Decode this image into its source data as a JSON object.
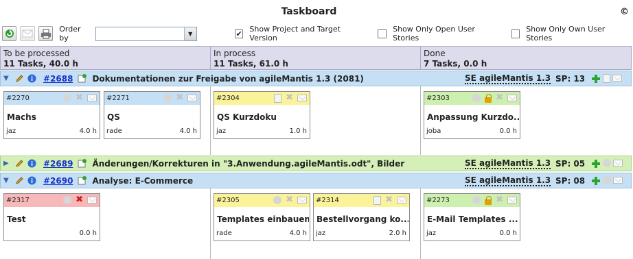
{
  "header": {
    "title": "Taskboard",
    "copyright": "©"
  },
  "toolbar": {
    "order_label": "Order by",
    "order_value": "",
    "show_project_label": "Show Project and Target Version",
    "show_open_label": "Show Only Open User Stories",
    "show_own_label": "Show Only Own User Stories",
    "show_project_checked": "✔"
  },
  "columns": [
    {
      "title": "To be processed",
      "summary": "11 Tasks, 40.0 h"
    },
    {
      "title": "In process",
      "summary": "11 Tasks, 61.0 h"
    },
    {
      "title": "Done",
      "summary": "7 Tasks, 0.0 h"
    }
  ],
  "stories": [
    {
      "id": "#2688",
      "name": "Dokumentationen zur Freigabe von agileMantis 1.3 (2081)",
      "version": "SE agileMantis 1.3",
      "sp": "SP: 13",
      "expanded": true,
      "color": "#c5e0f5"
    },
    {
      "id": "#2689",
      "name": "Änderungen/Korrekturen in \"3.Anwendung.agileMantis.odt\", Bilder",
      "version": "SE agileMantis 1.3",
      "sp": "SP: 05",
      "expanded": false,
      "color": "#d4f0b8"
    },
    {
      "id": "#2690",
      "name": "Analyse: E-Commerce",
      "version": "SE agileMantis 1.3",
      "sp": "SP: 08",
      "expanded": true,
      "color": "#c5e0f5"
    }
  ],
  "tasks": [
    {
      "id": "#2270",
      "title": "Machs",
      "user": "jaz",
      "estimate": "4.0 h"
    },
    {
      "id": "#2271",
      "title": "QS",
      "user": "rade",
      "estimate": "4.0 h"
    },
    {
      "id": "#2304",
      "title": "QS Kurzdoku",
      "user": "jaz",
      "estimate": "1.0 h"
    },
    {
      "id": "#2303",
      "title": "Anpassung Kurzdo...",
      "user": "joba",
      "estimate": "0.0 h"
    },
    {
      "id": "#2317",
      "title": "Test",
      "user": "",
      "estimate": "0.0 h"
    },
    {
      "id": "#2305",
      "title": "Templates einbauen",
      "user": "rade",
      "estimate": "4.0 h"
    },
    {
      "id": "#2314",
      "title": "Bestellvorgang ko...",
      "user": "jaz",
      "estimate": "2.0 h"
    },
    {
      "id": "#2273",
      "title": "E-Mail Templates ...",
      "user": "jaz",
      "estimate": "0.0 h"
    }
  ],
  "colors": {
    "story_blue": "#c5e0f5",
    "story_green": "#d4f0b8",
    "task_new": "#c5e0f5",
    "task_in_process": "#fbf39a",
    "task_done": "#cdf0b0",
    "task_blocked": "#f6b8b8",
    "link": "#1a33c9"
  },
  "icons": {
    "refresh": "refresh-icon",
    "mail": "mail-icon",
    "print": "print-icon",
    "edit": "pencil-icon",
    "info": "info-icon",
    "add": "add-icon"
  }
}
